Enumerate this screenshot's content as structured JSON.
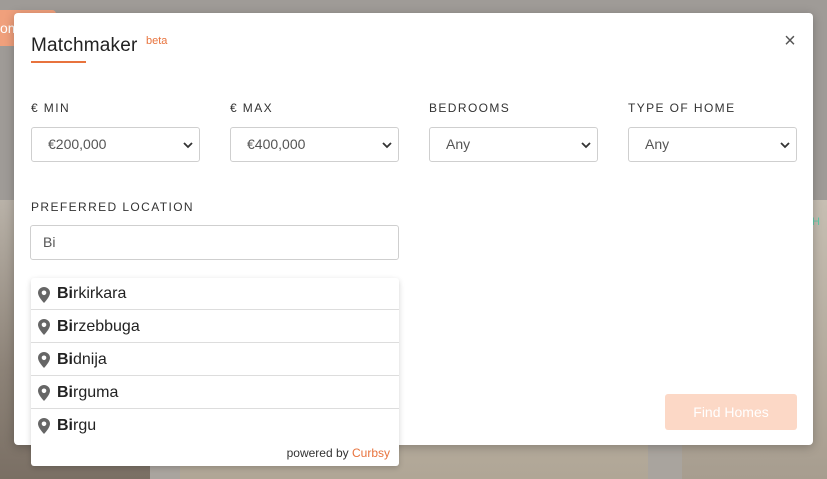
{
  "background": {
    "tab_fragment": "om",
    "teal_fragment": "H"
  },
  "modal": {
    "title": "Matchmaker",
    "badge": "beta",
    "close_symbol": "×"
  },
  "filters": {
    "min": {
      "label": "€ MIN",
      "value": "€200,000"
    },
    "max": {
      "label": "€ MAX",
      "value": "€400,000"
    },
    "bedrooms": {
      "label": "BEDROOMS",
      "value": "Any"
    },
    "type_of_home": {
      "label": "TYPE OF HOME",
      "value": "Any"
    }
  },
  "location": {
    "label": "PREFERRED LOCATION",
    "value": "Bi",
    "suggestions": [
      {
        "match": "Bi",
        "rest": "rkirkara"
      },
      {
        "match": "Bi",
        "rest": "rzebbuga"
      },
      {
        "match": "Bi",
        "rest": "dnija"
      },
      {
        "match": "Bi",
        "rest": "rguma"
      },
      {
        "match": "Bi",
        "rest": "rgu"
      }
    ],
    "powered_by_prefix": "powered by",
    "powered_by_brand": "Curbsy"
  },
  "actions": {
    "find_label": "Find Homes"
  },
  "icons": {
    "close": "close-icon",
    "dropdown": "chevron-down-icon",
    "location": "map-pin-icon"
  },
  "colors": {
    "accent": "#e8733d",
    "button_disabled": "#fcd8c6"
  }
}
